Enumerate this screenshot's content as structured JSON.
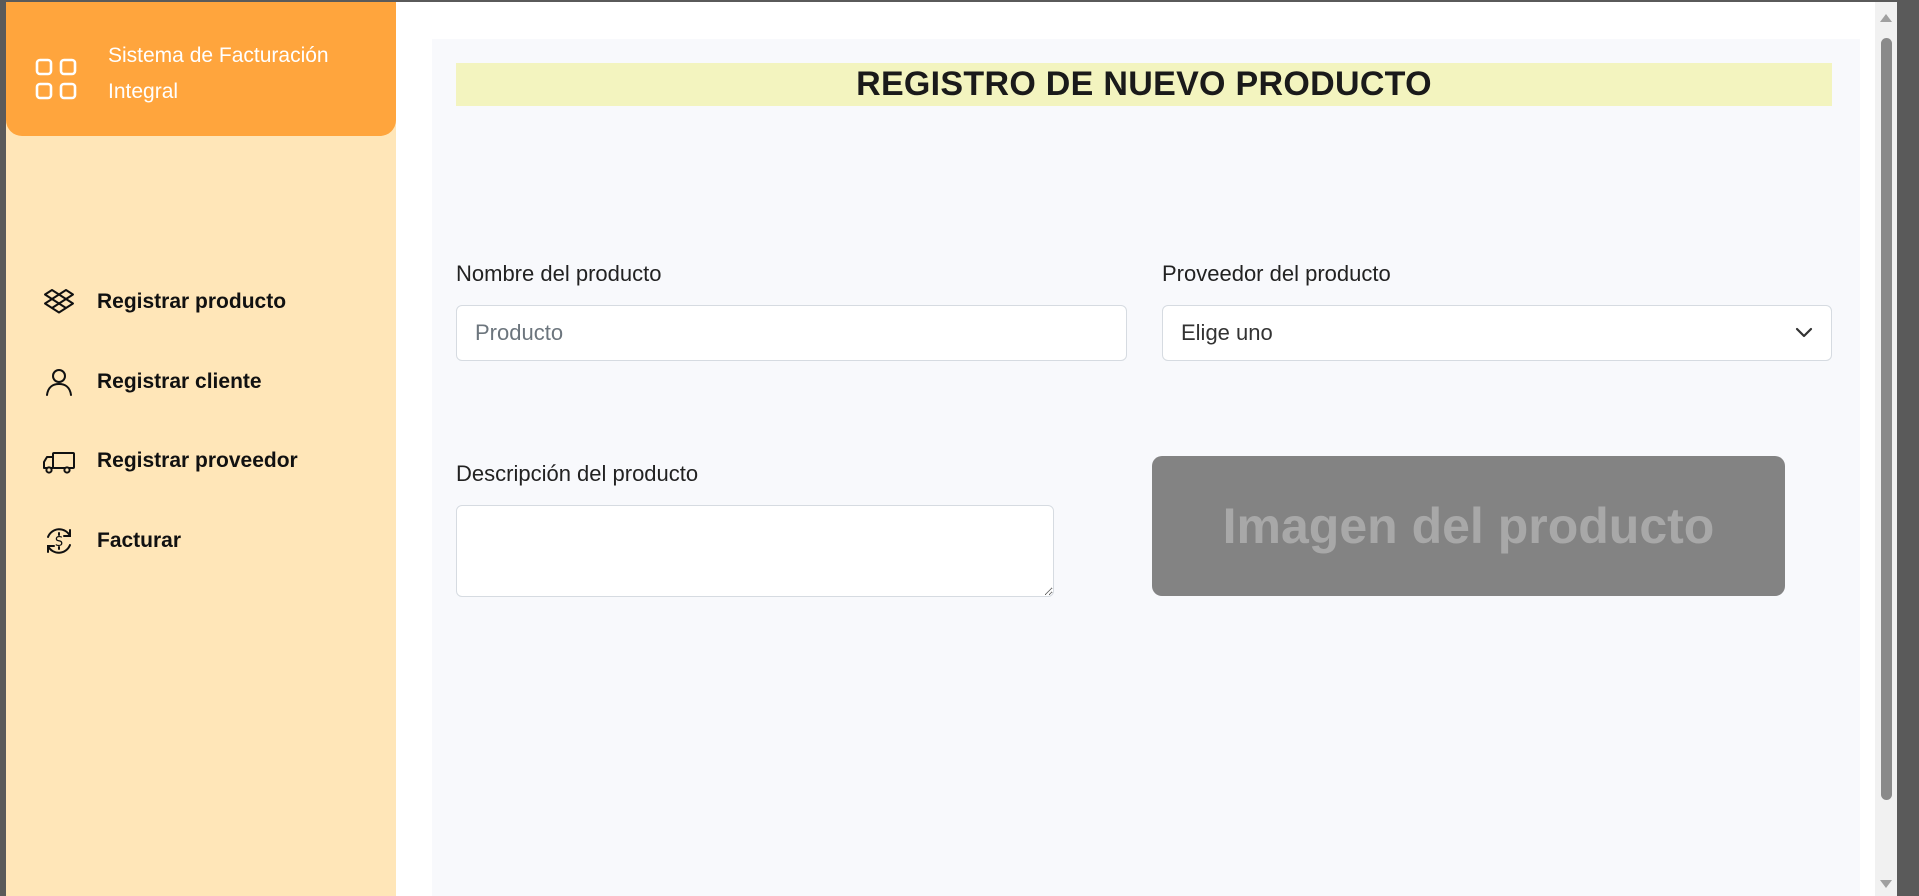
{
  "sidebar": {
    "brand": {
      "title": "Sistema de Facturación Integral",
      "icon": "grid-icon"
    },
    "items": [
      {
        "label": "Registrar producto",
        "icon": "dropbox-box-icon"
      },
      {
        "label": "Registrar cliente",
        "icon": "user-icon"
      },
      {
        "label": "Registrar proveedor",
        "icon": "truck-icon"
      },
      {
        "label": "Facturar",
        "icon": "dollar-cycle-icon"
      }
    ]
  },
  "main": {
    "title": "REGISTRO DE NUEVO PRODUCTO",
    "form": {
      "name_label": "Nombre del producto",
      "name_placeholder": "Producto",
      "name_value": "",
      "supplier_label": "Proveedor del producto",
      "supplier_selected": "Elige uno",
      "description_label": "Descripción del producto",
      "description_value": "",
      "image_placeholder": "Imagen del producto"
    }
  },
  "colors": {
    "brand": "#ffa53d",
    "sidebar": "#ffe6b8",
    "title_bar": "#f3f4bf",
    "image_box": "#838383",
    "main_bg": "#f8f9fc"
  }
}
